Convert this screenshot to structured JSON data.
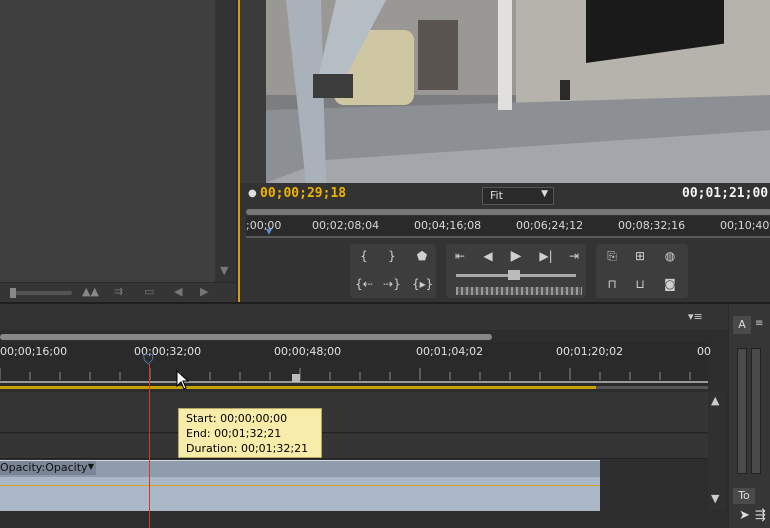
{
  "colors": {
    "accent_orange": "#d89a1e",
    "timecode_yellow": "#f0b400",
    "playhead_red": "#d23a2a",
    "tooltip_bg": "#f7ecaa",
    "clip_blue": "#a9b7c6"
  },
  "monitor": {
    "current_timecode": "00;00;29;18",
    "zoom_select": "Fit",
    "duration_timecode": "00;01;21;00",
    "ruler_labels": [
      ";00;00",
      "00;02;08;04",
      "00;04;16;08",
      "00;06;24;12",
      "00;08;32;16",
      "00;10;40"
    ]
  },
  "timeline": {
    "ruler_labels": [
      "00;00;16;00",
      "00;00;32;00",
      "00;00;48;00",
      "00;01;04;02",
      "00;01;20;02",
      "00"
    ],
    "track_label": "Opacity:Opacity",
    "tooltip": {
      "start": "Start: 00;00;00;00",
      "end": "End: 00;01;32;21",
      "duration": "Duration: 00;01;32;21"
    }
  },
  "panels": {
    "meters_label": "A",
    "tools_label": "To"
  },
  "icons": [
    "zoom-mountain-icon",
    "set-in-icon",
    "set-out-icon",
    "marker-icon",
    "go-to-in-icon",
    "step-back-icon",
    "play-icon",
    "step-forward-icon",
    "go-to-out-icon",
    "insert-icon",
    "overwrite-icon",
    "lift-icon",
    "extract-icon",
    "export-frame-icon",
    "panel-menu-icon",
    "scroll-up-icon",
    "scroll-down-icon",
    "selection-tool-icon"
  ]
}
